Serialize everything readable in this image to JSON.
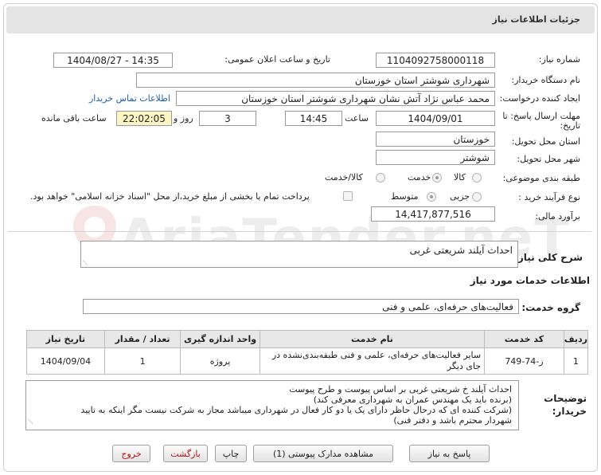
{
  "header": {
    "title": "جزئیات اطلاعات نیاز"
  },
  "form": {
    "need_number_label": "شماره نیاز:",
    "need_number": "1104092758000118",
    "announce_label": "تاریخ و ساعت اعلان عمومی:",
    "announce_value": "1404/08/27 - 14:35",
    "buyer_org_label": "نام دستگاه خریدار:",
    "buyer_org": "شهرداری شوشتر استان خوزستان",
    "creator_label": "ایجاد کننده درخواست:",
    "creator": "محمد عباس نژاد آتش نشان شهرداری شوشتر استان خوزستان",
    "contact_link": "اطلاعات تماس خریدار",
    "deadline_label_1": "مهلت ارسال پاسخ: تا",
    "deadline_label_2": "تاریخ:",
    "deadline_date": "1404/09/01",
    "time_label": "ساعت",
    "deadline_time": "14:45",
    "days_value": "3",
    "days_label": "روز و",
    "remaining_time": "22:02:05",
    "remaining_label": "ساعت باقی مانده",
    "province_label": "استان محل تحویل:",
    "province": "خوزستان",
    "city_label": "شهر محل تحویل:",
    "city": "شوشتر",
    "category_label": "طبقه بندی موضوعی:",
    "category_options": [
      "کالا",
      "خدمت",
      "کالا/خدمت"
    ],
    "process_label": "نوع فرآیند خرید :",
    "process_options": [
      "جزیی",
      "متوسط"
    ],
    "treasury_note": "پرداخت تمام یا بخشی از مبلغ خرید،از محل \"اسناد خزانه اسلامی\" خواهد بود.",
    "estimate_label": "برآورد مالی:",
    "estimate": "14,417,877,516"
  },
  "summary": {
    "label": "شرح کلی نیاز:",
    "value": "احداث آیلند شریعتی غربی"
  },
  "services": {
    "section_title": "اطلاعات خدمات مورد نیاز",
    "group_label": "گروه خدمت:",
    "group_value": "فعالیت‌های حرفه‌ای، علمی و فنی"
  },
  "table": {
    "headers": [
      "ردیف",
      "کد خدمت",
      "نام خدمت",
      "واحد اندازه گیری",
      "تعداد / مقدار",
      "تاریخ نیاز"
    ],
    "rows": [
      [
        "1",
        "ز-74-749",
        "سایر فعالیت‌های حرفه‌ای، علمی و فنی طبقه‌بندی‌نشده در جای دیگر",
        "پروژه",
        "1",
        "1404/09/04"
      ]
    ]
  },
  "buyer_notes": {
    "label_1": "توضیحات",
    "label_2": "خریدار:",
    "lines": [
      "احداث آیلند خ شریعتی غربی بر اساس پیوست و طرح پیوست",
      "(برنده باید یک مهندس عمران به شهرداری معرفی کند)",
      "(شرکت کننده ای که درحال حاظر دارای یک یا دو کار فعال در شهرداری میباشد مجاز به شرکت نیست مگر اینکه به تایید",
      "شهردار محترم باشد و دفتر فنی)"
    ]
  },
  "buttons": {
    "reply": "پاسخ به نیاز",
    "attachments": "مشاهده مدارک پیوستی (1)",
    "print": "چاپ",
    "back": "بازگشت",
    "exit": "خروج"
  },
  "watermark": "AriaTender.neT",
  "colors": {
    "link": "#1a5fb4",
    "yellow_box": "#fdf6c4",
    "header_bg": "#e4e4e4",
    "danger_text": "#b31212"
  }
}
